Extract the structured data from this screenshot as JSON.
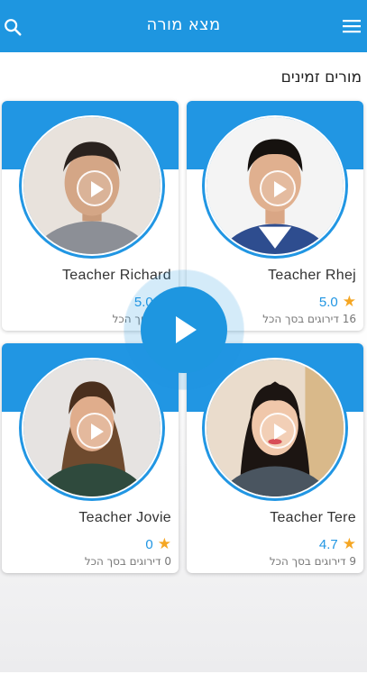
{
  "header": {
    "title": "מצא מורה",
    "search_icon": "search-icon",
    "menu_icon": "hamburger-menu-icon",
    "color": "#1e96e0"
  },
  "section": {
    "title": "מורים זמינים"
  },
  "teachers": [
    {
      "name": "Teacher Richard",
      "rating": "5.0",
      "reviews": "גים בסך הכל"
    },
    {
      "name": "Teacher Rhej",
      "rating": "5.0",
      "reviews": "16 דירוגים בסך הכל"
    },
    {
      "name": "Teacher Jovie",
      "rating": "0",
      "reviews": "0 דירוגים בסך הכל"
    },
    {
      "name": "Teacher Tere",
      "rating": "4.7",
      "reviews": "9 דירוגים בסך הכל"
    }
  ],
  "overlay": {
    "icon": "play-icon"
  },
  "colors": {
    "accent": "#2196e3",
    "star": "#f5a623"
  }
}
